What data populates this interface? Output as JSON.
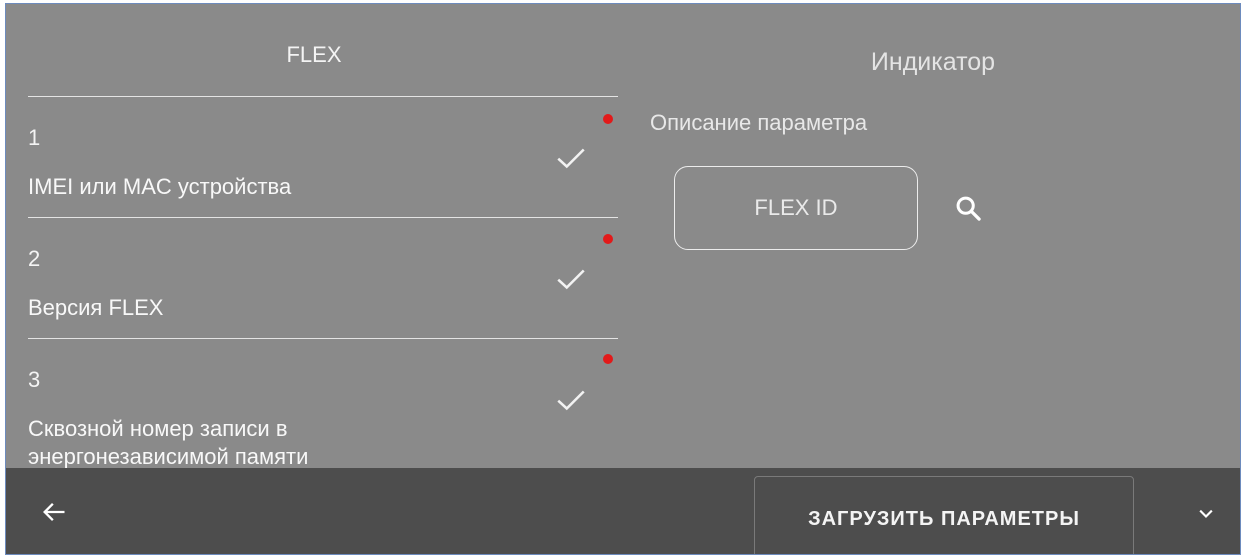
{
  "left_panel": {
    "title": "FLEX",
    "items": [
      {
        "number": "1",
        "label": "IMEI или MAC устройства"
      },
      {
        "number": "2",
        "label": "Версия FLEX"
      },
      {
        "number": "3",
        "label": "Сквозной номер записи в энергонезависимой памяти"
      }
    ]
  },
  "right_panel": {
    "title": "Индикатор",
    "description": "Описание параметра",
    "field_placeholder": "FLEX ID"
  },
  "bottom_bar": {
    "load_button": "ЗАГРУЗИТЬ ПАРАМЕТРЫ"
  },
  "icons": {
    "back": "arrow-left-icon",
    "search": "search-icon",
    "chevron": "chevron-down-icon",
    "check": "check-icon",
    "status_dot": "status-dot-icon"
  },
  "colors": {
    "background": "#8a8a8a",
    "bar": "#4d4d4d",
    "status_dot": "#e21a1a",
    "divider": "#e4e4e4"
  }
}
